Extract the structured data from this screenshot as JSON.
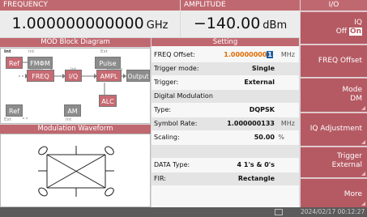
{
  "header": {
    "frequency_label": "FREQUENCY",
    "amplitude_label": "AMPLITUDE",
    "io_label": "I/O"
  },
  "frequency": {
    "value": "1.000000000000",
    "unit": "GHz"
  },
  "amplitude": {
    "value": "−140.00",
    "unit": "dBm"
  },
  "mod_block": {
    "title": "MOD Block Diagram",
    "int_label": "Int",
    "int_label2": "Int",
    "ext_label": "Ext",
    "ext_label2": "Ext",
    "sweep_label": "Sweep",
    "sweep_label2": "Sweep",
    "int_label3": "Int",
    "int_label4": "Int",
    "blocks": {
      "ref": "Ref",
      "fmpm": "FMΦM",
      "pulse": "Pulse",
      "freq": "FREQ",
      "iq": "I/Q",
      "ampl": "AMPL",
      "output": "Output",
      "ref2": "Ref",
      "am": "AM",
      "alc": "ALC"
    }
  },
  "waveform": {
    "title": "Modulation Waveform"
  },
  "setting": {
    "title": "Setting",
    "rows": [
      {
        "label": "FREQ Offset:",
        "value": "1.00000000",
        "cursor": "1",
        "unit": "MHz"
      },
      {
        "label": "Trigger mode:",
        "value": "Single",
        "unit": ""
      },
      {
        "label": "Trigger:",
        "value": "External",
        "unit": ""
      },
      {
        "label": "Digital Modulation",
        "value": "",
        "unit": ""
      },
      {
        "label": "Type:",
        "value": "DQPSK",
        "unit": ""
      },
      {
        "label": "Symbol Rate:",
        "value": "1.000000133",
        "unit": "MHz"
      },
      {
        "label": "Scaling:",
        "value": "50.00",
        "unit": "%"
      },
      {
        "label": "",
        "value": "",
        "unit": ""
      },
      {
        "label": "DATA Type:",
        "value": "4 1's & 0's",
        "unit": ""
      },
      {
        "label": "FIR:",
        "value": "Rectangle",
        "unit": ""
      }
    ]
  },
  "softkeys": {
    "iq": {
      "title": "IQ",
      "off": "Off",
      "on": "On"
    },
    "freq_offset": "FREQ Offset",
    "mode": {
      "title": "Mode",
      "value": "DM"
    },
    "iq_adjust": "IQ Adjustment",
    "trigger": {
      "title": "Trigger",
      "value": "External"
    },
    "more": "More"
  },
  "status": {
    "datetime": "2024/02/17 00:12:27"
  },
  "colors": {
    "accent": "#c06870",
    "softkey": "#b55a63",
    "status_bar": "#5b5b5b"
  }
}
